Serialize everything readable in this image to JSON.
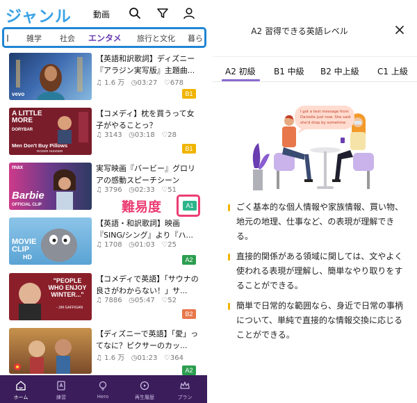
{
  "left": {
    "header": {
      "title": "ジャンル",
      "video": "動画"
    },
    "categories": [
      "雑学",
      "社会",
      "エンタメ",
      "旅行と文化",
      "暮ら"
    ],
    "items": [
      {
        "title": "【英語和訳歌詞】ディズニー『アラジン実写版』主題曲...",
        "views": "1.6 万",
        "duration": "03:27",
        "likes": "678",
        "level": "B1",
        "thumb_text": ""
      },
      {
        "title": "【コメディ】枕を買うって女子がやることっ？",
        "views": "3143",
        "duration": "03:18",
        "likes": "28",
        "level": "B1",
        "thumb_text": "Men Don't Buy Pillows"
      },
      {
        "title": "実写映画『バービー』グロリアの感動スピーチシーン",
        "views": "3796",
        "duration": "02:33",
        "likes": "51",
        "level": "A1",
        "thumb_text": "Barbie"
      },
      {
        "title": "【英語・和訳歌詞】映画『SING/シング』より『ハ...",
        "views": "1708",
        "duration": "01:03",
        "likes": "25",
        "level": "A2",
        "thumb_text": "MOVIE CLIP"
      },
      {
        "title": "【コメディで英語】「サウナの良さがわからない！」サ...",
        "views": "7886",
        "duration": "05:47",
        "likes": "52",
        "level": "B2",
        "thumb_text": "\"PEOPLE WHO ENJOY WINTER...\""
      },
      {
        "title": "【ディズニーで英語】「愛」ってなに？ピクサーのカッ...",
        "views": "1.6 万",
        "duration": "01:23",
        "likes": "364",
        "level": "A2",
        "thumb_text": ""
      }
    ],
    "thumb_extra": {
      "vevo": "vevo",
      "little_more": "A LITTLE MORE",
      "dorybar": "DORYBAR",
      "roger": "ROGER HUNGER",
      "max": "max",
      "official": "OFFICIAL CLIP",
      "hd": "HD",
      "gaffigan": "- JIM GAFFIGAN"
    },
    "annotation": {
      "difficulty": "難易度"
    },
    "tabs": [
      "ホーム",
      "練習",
      "Hero",
      "再生履歴",
      "プラン"
    ]
  },
  "right": {
    "title": "A2 習得できる英語レベル",
    "level_tabs": [
      "A2 初級",
      "B1 中級",
      "B2 中上級",
      "C1 上級"
    ],
    "speech_bubble": "I got a text message from Danielle just now. She said she'd drop by sometime",
    "bullets": [
      "ごく基本的な個人情報や家族情報、買い物、地元の地理、仕事など、の表現が理解できる。",
      "直接的関係がある領域に関しては、文やよく使われる表現が理解し、簡単なやり取りをすることができる。",
      "簡単で日常的な範囲なら、身近で日常の事柄について、単純で直接的な情報交換に応じることができる。"
    ]
  },
  "colors": {
    "accent": "#6a3db0",
    "brand_blue": "#3aa2e6",
    "highlight_pink": "#ec3d73",
    "tab_bar": "#3a1d5a",
    "level_B1": "#f0b400",
    "level_A1": "#2cb58a",
    "level_A2": "#2c9e4f",
    "level_B2": "#e8774b",
    "bullet_mark": "#f0b400"
  }
}
